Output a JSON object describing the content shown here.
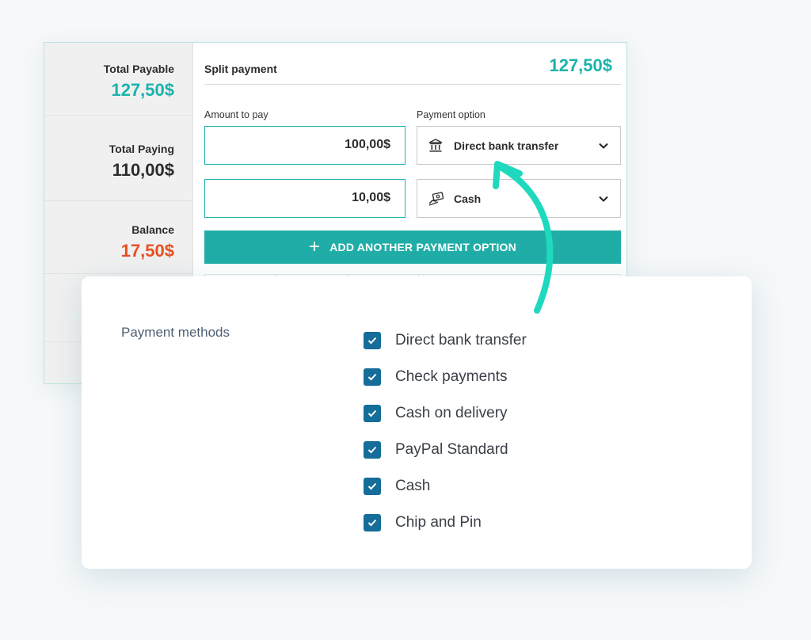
{
  "colors": {
    "accent": "#1ab3ad",
    "button": "#21ada7",
    "balance": "#e8501f",
    "checkbox": "#156d99",
    "arrow": "#1ed9bd"
  },
  "summary": {
    "total_payable_label": "Total Payable",
    "total_payable_value": "127,50$",
    "total_paying_label": "Total Paying",
    "total_paying_value": "110,00$",
    "balance_label": "Balance",
    "balance_value": "17,50$"
  },
  "split": {
    "title": "Split payment",
    "total": "127,50$",
    "amount_label": "Amount to pay",
    "option_label": "Payment option",
    "rows": [
      {
        "amount": "100,00$",
        "option": "Direct bank transfer",
        "icon": "bank-icon"
      },
      {
        "amount": "10,00$",
        "option": "Cash",
        "icon": "cash-hand-icon"
      }
    ],
    "add_button": "ADD ANOTHER PAYMENT OPTION"
  },
  "payment_methods": {
    "label": "Payment methods",
    "items": [
      {
        "label": "Direct bank transfer",
        "checked": true
      },
      {
        "label": "Check payments",
        "checked": true
      },
      {
        "label": "Cash on delivery",
        "checked": true
      },
      {
        "label": "PayPal Standard",
        "checked": true
      },
      {
        "label": "Cash",
        "checked": true
      },
      {
        "label": "Chip and Pin",
        "checked": true
      }
    ]
  }
}
